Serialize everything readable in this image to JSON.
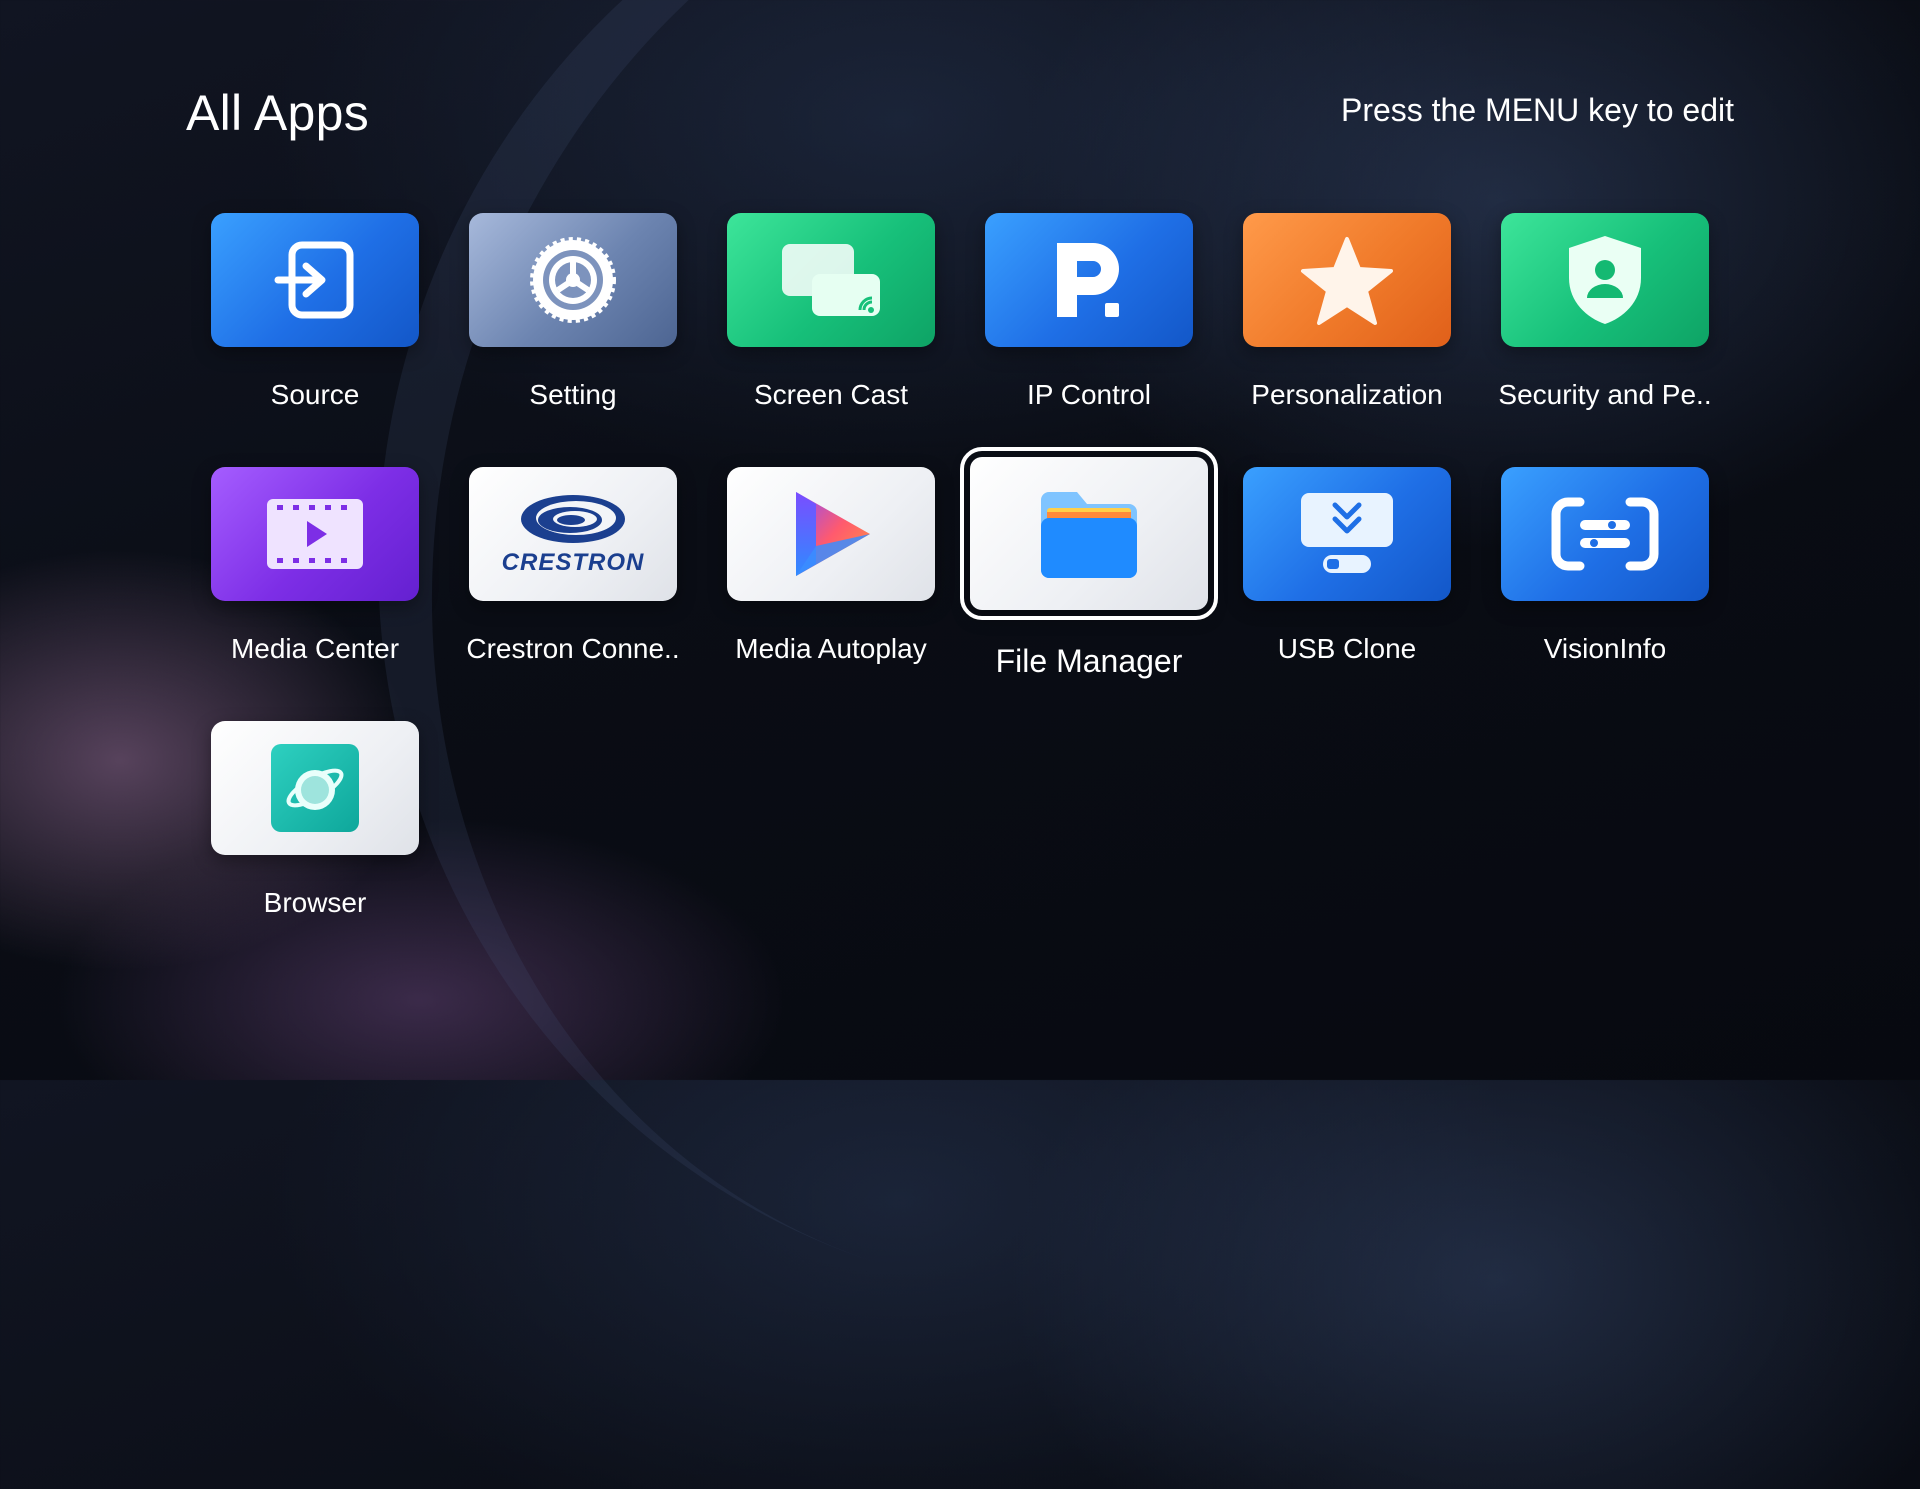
{
  "header": {
    "title": "All Apps",
    "hint": "Press the MENU key to edit"
  },
  "apps": [
    {
      "label": "Source",
      "icon": "source-input-icon",
      "color": "#2a86f2"
    },
    {
      "label": "Setting",
      "icon": "gear-icon",
      "color": "#7d93bd"
    },
    {
      "label": "Screen Cast",
      "icon": "screen-cast-icon",
      "color": "#1bc77f"
    },
    {
      "label": "IP Control",
      "icon": "ip-control-icon",
      "color": "#2a86f2"
    },
    {
      "label": "Personalization",
      "icon": "star-icon",
      "color": "#f07a2a"
    },
    {
      "label": "Security and Pe..",
      "icon": "shield-user-icon",
      "color": "#1bc77f"
    },
    {
      "label": "Media Center",
      "icon": "video-film-icon",
      "color": "#7d2ee6"
    },
    {
      "label": "Crestron Conne..",
      "icon": "crestron-logo-icon",
      "color": "#ffffff"
    },
    {
      "label": "Media Autoplay",
      "icon": "play-icon",
      "color": "#ffffff"
    },
    {
      "label": "File Manager",
      "icon": "folder-icon",
      "color": "#ffffff",
      "focused": true
    },
    {
      "label": "USB Clone",
      "icon": "usb-clone-icon",
      "color": "#2a86f2"
    },
    {
      "label": "VisionInfo",
      "icon": "vision-info-icon",
      "color": "#2a86f2"
    },
    {
      "label": "Browser",
      "icon": "browser-globe-icon",
      "color": "#ffffff"
    }
  ],
  "logos": {
    "crestron_text": "CRESTRON"
  }
}
